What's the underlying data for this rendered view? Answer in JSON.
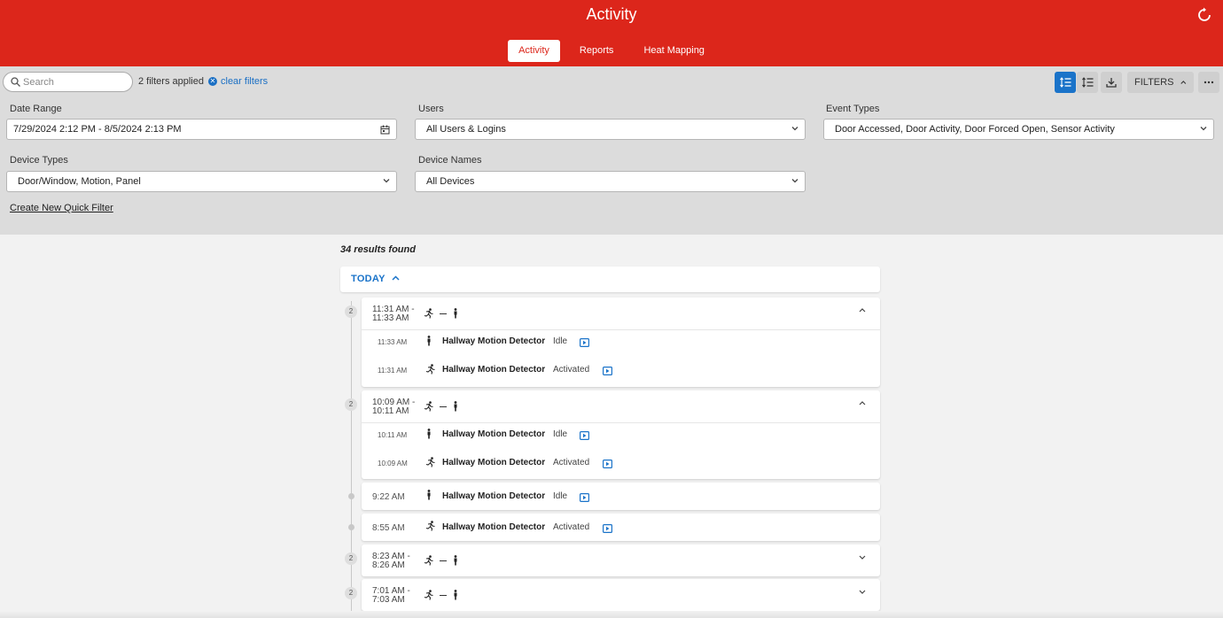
{
  "header": {
    "title": "Activity",
    "tabs": [
      {
        "label": "Activity",
        "active": true
      },
      {
        "label": "Reports",
        "active": false
      },
      {
        "label": "Heat Mapping",
        "active": false
      }
    ]
  },
  "toolbar": {
    "search_placeholder": "Search",
    "filters_applied": "2 filters applied",
    "clear_filters": "clear filters",
    "filters_button": "FILTERS"
  },
  "filters": {
    "date_range": {
      "label": "Date Range",
      "value": "7/29/2024 2:12 PM - 8/5/2024 2:13 PM"
    },
    "users": {
      "label": "Users",
      "value": "All Users & Logins"
    },
    "event_types": {
      "label": "Event Types",
      "value": "Door Accessed, Door Activity, Door Forced Open, Sensor Activity"
    },
    "device_types": {
      "label": "Device Types",
      "value": "Door/Window, Motion, Panel"
    },
    "device_names": {
      "label": "Device Names",
      "value": "All Devices"
    },
    "quick_filter": "Create New Quick Filter"
  },
  "results": {
    "summary": "34 results found",
    "section": "TODAY",
    "groups": [
      {
        "count": "2",
        "time_start": "11:31 AM -",
        "time_end": "11:33 AM",
        "events": [
          {
            "time": "11:33 AM",
            "device": "Hallway Motion Detector",
            "status": "Idle",
            "icon": "person-standing-icon"
          },
          {
            "time": "11:31 AM",
            "device": "Hallway Motion Detector",
            "status": "Activated",
            "icon": "person-running-icon"
          }
        ]
      },
      {
        "count": "2",
        "time_start": "10:09 AM -",
        "time_end": "10:11 AM",
        "events": [
          {
            "time": "10:11 AM",
            "device": "Hallway Motion Detector",
            "status": "Idle",
            "icon": "person-standing-icon"
          },
          {
            "time": "10:09 AM",
            "device": "Hallway Motion Detector",
            "status": "Activated",
            "icon": "person-running-icon"
          }
        ]
      }
    ],
    "singles": [
      {
        "time": "9:22 AM",
        "device": "Hallway Motion Detector",
        "status": "Idle",
        "icon": "person-standing-icon"
      },
      {
        "time": "8:55 AM",
        "device": "Hallway Motion Detector",
        "status": "Activated",
        "icon": "person-running-icon"
      }
    ],
    "collapsed_groups": [
      {
        "count": "2",
        "time_start": "8:23 AM -",
        "time_end": "8:26 AM"
      },
      {
        "count": "2",
        "time_start": "7:01 AM -",
        "time_end": "7:03 AM"
      }
    ]
  },
  "colors": {
    "brand_red": "#dc261b",
    "accent_blue": "#1a73c9",
    "panel_gray": "#dcdcdc"
  }
}
